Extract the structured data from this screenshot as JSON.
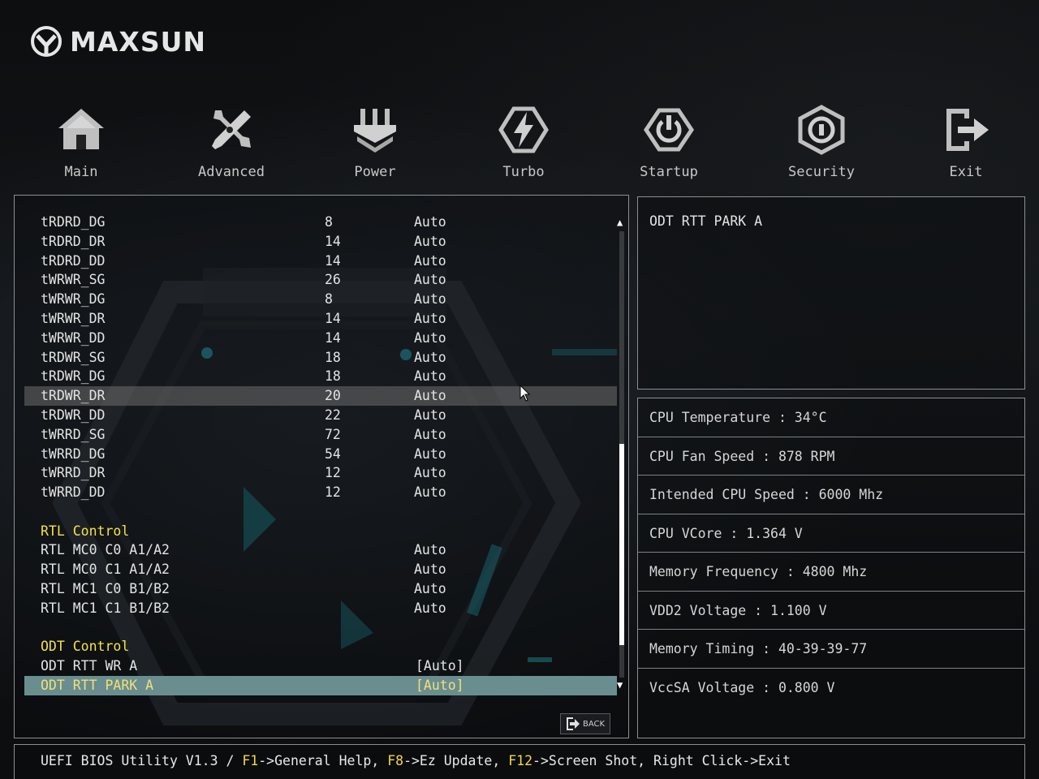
{
  "brand": {
    "name": "MAXSUN"
  },
  "nav": [
    {
      "label": "Main",
      "icon": "home-icon"
    },
    {
      "label": "Advanced",
      "icon": "tools-icon"
    },
    {
      "label": "Power",
      "icon": "power-plug-icon"
    },
    {
      "label": "Turbo",
      "icon": "lightning-icon"
    },
    {
      "label": "Startup",
      "icon": "startup-power-icon"
    },
    {
      "label": "Security",
      "icon": "shield-lock-icon"
    },
    {
      "label": "Exit",
      "icon": "exit-icon"
    }
  ],
  "settings": {
    "timings": [
      {
        "name": "tRDRD_DG",
        "value": "8",
        "setting": "Auto"
      },
      {
        "name": "tRDRD_DR",
        "value": "14",
        "setting": "Auto"
      },
      {
        "name": "tRDRD_DD",
        "value": "14",
        "setting": "Auto"
      },
      {
        "name": "tWRWR_SG",
        "value": "26",
        "setting": "Auto"
      },
      {
        "name": "tWRWR_DG",
        "value": "8",
        "setting": "Auto"
      },
      {
        "name": "tWRWR_DR",
        "value": "14",
        "setting": "Auto"
      },
      {
        "name": "tWRWR_DD",
        "value": "14",
        "setting": "Auto"
      },
      {
        "name": "tRDWR_SG",
        "value": "18",
        "setting": "Auto"
      },
      {
        "name": "tRDWR_DG",
        "value": "18",
        "setting": "Auto"
      },
      {
        "name": "tRDWR_DR",
        "value": "20",
        "setting": "Auto"
      },
      {
        "name": "tRDWR_DD",
        "value": "22",
        "setting": "Auto"
      },
      {
        "name": "tWRRD_SG",
        "value": "72",
        "setting": "Auto"
      },
      {
        "name": "tWRRD_DG",
        "value": "54",
        "setting": "Auto"
      },
      {
        "name": "tWRRD_DR",
        "value": "12",
        "setting": "Auto"
      },
      {
        "name": "tWRRD_DD",
        "value": "12",
        "setting": "Auto"
      }
    ],
    "rtl_title": "RTL Control",
    "rtl": [
      {
        "name": "RTL MC0 C0 A1/A2",
        "setting": "Auto"
      },
      {
        "name": "RTL MC0 C1 A1/A2",
        "setting": "Auto"
      },
      {
        "name": "RTL MC1 C0 B1/B2",
        "setting": "Auto"
      },
      {
        "name": "RTL MC1 C1 B1/B2",
        "setting": "Auto"
      }
    ],
    "odt_title": "ODT Control",
    "odt": [
      {
        "name": "ODT RTT WR A",
        "setting": "[Auto]"
      },
      {
        "name": "ODT RTT PARK A",
        "setting": "[Auto]"
      }
    ],
    "back_label": "BACK"
  },
  "help": {
    "text": "ODT RTT PARK A"
  },
  "stats": [
    "CPU Temperature : 34°C",
    "CPU Fan Speed : 878 RPM",
    "Intended CPU Speed : 6000 Mhz",
    "CPU VCore : 1.364 V",
    "Memory Frequency : 4800 Mhz",
    "VDD2 Voltage : 1.100 V",
    "Memory Timing : 40-39-39-77",
    "VccSA Voltage : 0.800 V"
  ],
  "status_bar": {
    "prefix": "UEFI BIOS Utility V1.3 / ",
    "f1_key": "F1",
    "f1_text": "->General Help, ",
    "f8_key": "F8",
    "f8_text": "->Ez Update, ",
    "f12_key": "F12",
    "f12_text": "->Screen Shot, Right Click->Exit"
  },
  "colors": {
    "section_title": "#f2e24a",
    "selected_row_bg": "#6a8e8f",
    "selected_row_text": "#f0e07a",
    "hover_row_bg": "#6e6e6e",
    "panel_border": "#8b8f94",
    "key_highlight": "#f2d64a"
  }
}
